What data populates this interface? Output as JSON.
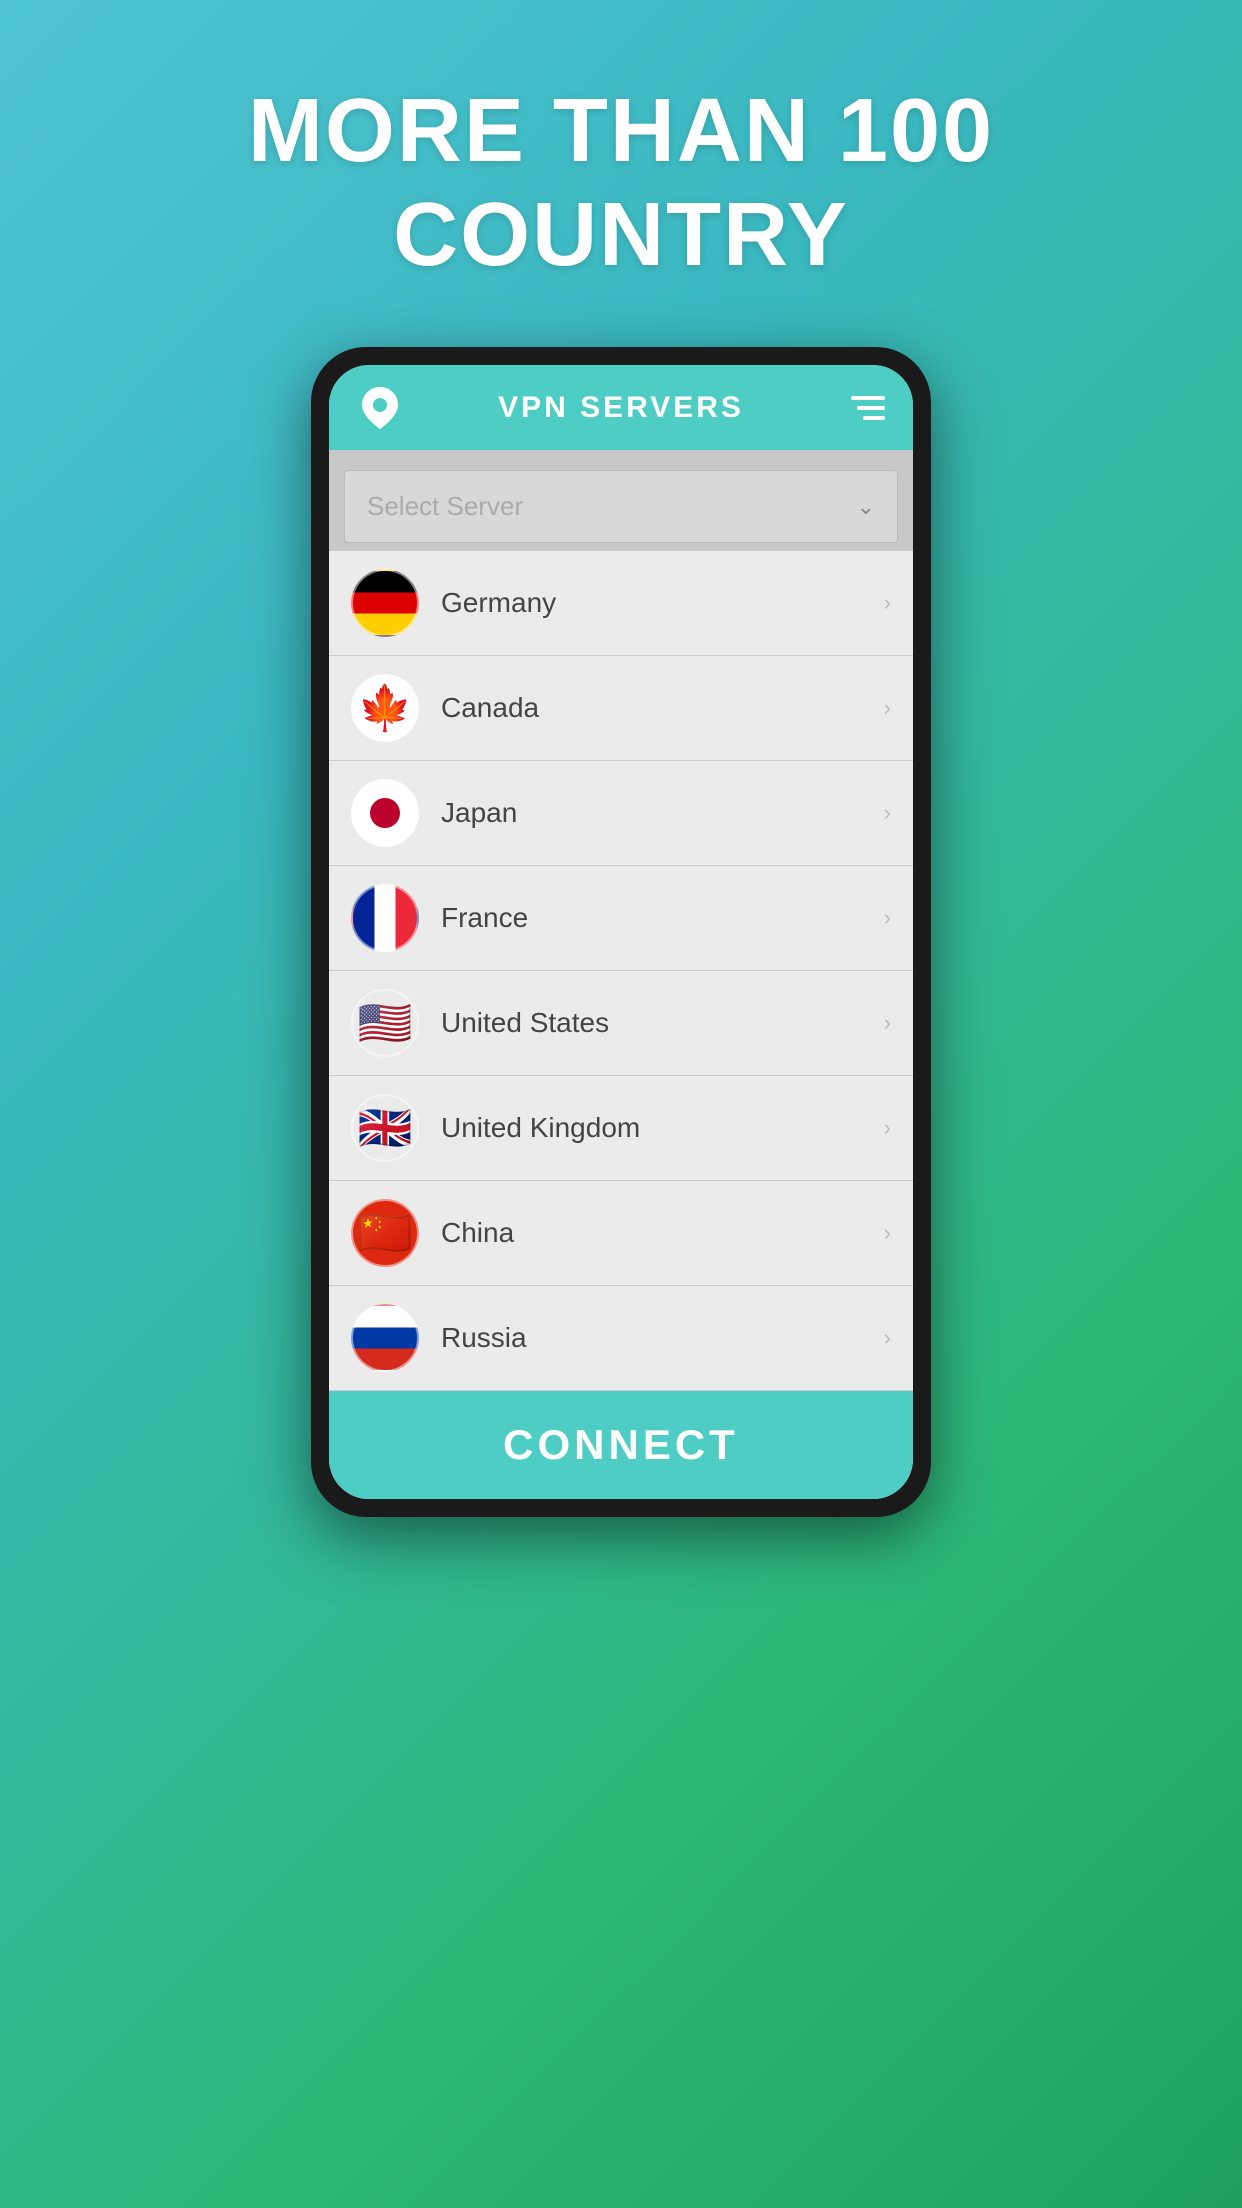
{
  "headline": {
    "line1": "MORE THAN 100",
    "line2": "COUNTRY"
  },
  "app": {
    "title": "VPN SERVERS",
    "select_placeholder": "Select Server",
    "connect_label": "CONNECT"
  },
  "countries": [
    {
      "name": "Germany",
      "flag_emoji": "🇩🇪"
    },
    {
      "name": "Canada",
      "flag_emoji": "🇨🇦"
    },
    {
      "name": "Japan",
      "flag_emoji": "🇯🇵"
    },
    {
      "name": "France",
      "flag_emoji": "🇫🇷"
    },
    {
      "name": "United States",
      "flag_emoji": "🇺🇸"
    },
    {
      "name": "United Kingdom",
      "flag_emoji": "🇬🇧"
    },
    {
      "name": "China",
      "flag_emoji": "🇨🇳"
    },
    {
      "name": "Russia",
      "flag_emoji": "🇷🇺"
    }
  ]
}
